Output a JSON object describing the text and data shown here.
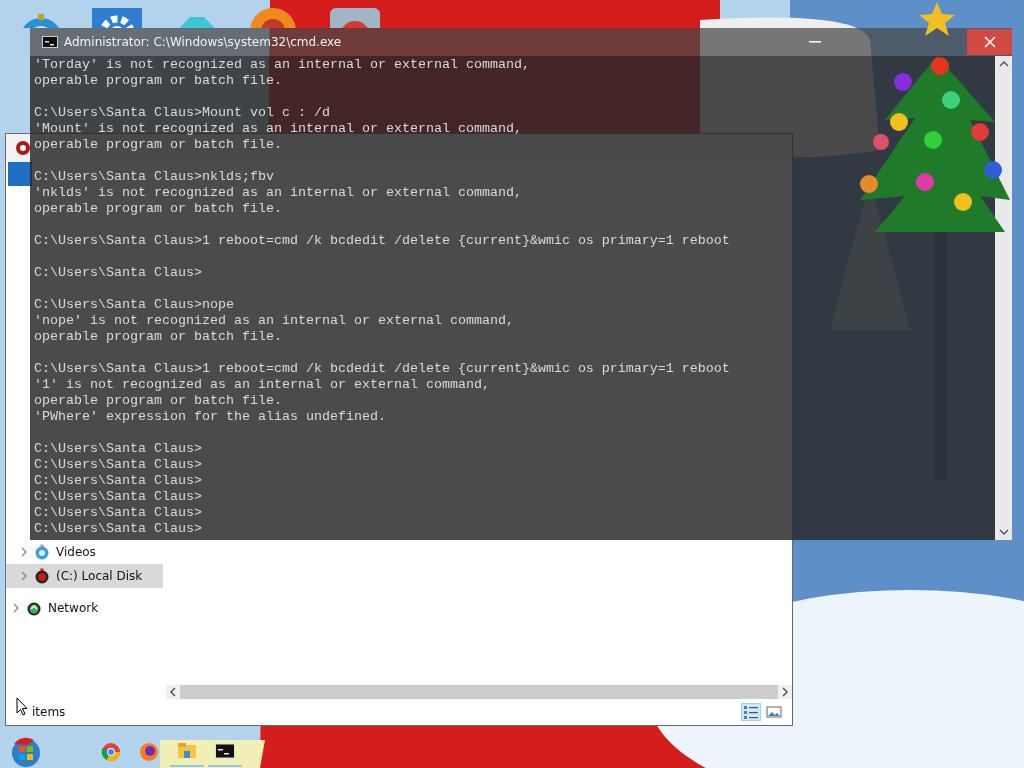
{
  "cmd_window": {
    "title": "Administrator: C:\\Windows\\system32\\cmd.exe",
    "output_blocks": [
      [
        "'Torday' is not recognized as an internal or external command,",
        "operable program or batch file."
      ],
      [
        "C:\\Users\\Santa Claus>Mount vol c : /d",
        "'Mount' is not recognized as an internal or external command,",
        "operable program or batch file."
      ],
      [
        "C:\\Users\\Santa Claus>nklds;fbv",
        "'nklds' is not recognized as an internal or external command,",
        "operable program or batch file."
      ],
      [
        "C:\\Users\\Santa Claus>1 reboot=cmd /k bcdedit /delete {current}&wmic os primary=1 reboot"
      ],
      [
        "C:\\Users\\Santa Claus>"
      ],
      [
        "C:\\Users\\Santa Claus>nope",
        "'nope' is not recognized as an internal or external command,",
        "operable program or batch file."
      ],
      [
        "C:\\Users\\Santa Claus>1 reboot=cmd /k bcdedit /delete {current}&wmic os primary=1 reboot",
        "'1' is not recognized as an internal or external command,",
        "operable program or batch file.",
        "'PWhere' expression for the alias undefined."
      ],
      [
        "C:\\Users\\Santa Claus>",
        "C:\\Users\\Santa Claus>",
        "C:\\Users\\Santa Claus>",
        "C:\\Users\\Santa Claus>",
        "C:\\Users\\Santa Claus>",
        "C:\\Users\\Santa Claus>"
      ]
    ]
  },
  "explorer_window": {
    "nav": {
      "this_pc": [
        {
          "label": "Videos",
          "selected": false
        },
        {
          "label": "(C:) Local Disk",
          "selected": true
        }
      ],
      "network": {
        "label": "Network",
        "selected": false
      }
    },
    "status_bar": {
      "item_count": "items"
    },
    "view_buttons": [
      {
        "selected": true
      },
      {
        "selected": false
      }
    ]
  },
  "taskbar": {
    "apps": [
      {
        "running": false
      },
      {
        "running": false
      },
      {
        "running": true
      },
      {
        "running": true
      }
    ]
  }
}
